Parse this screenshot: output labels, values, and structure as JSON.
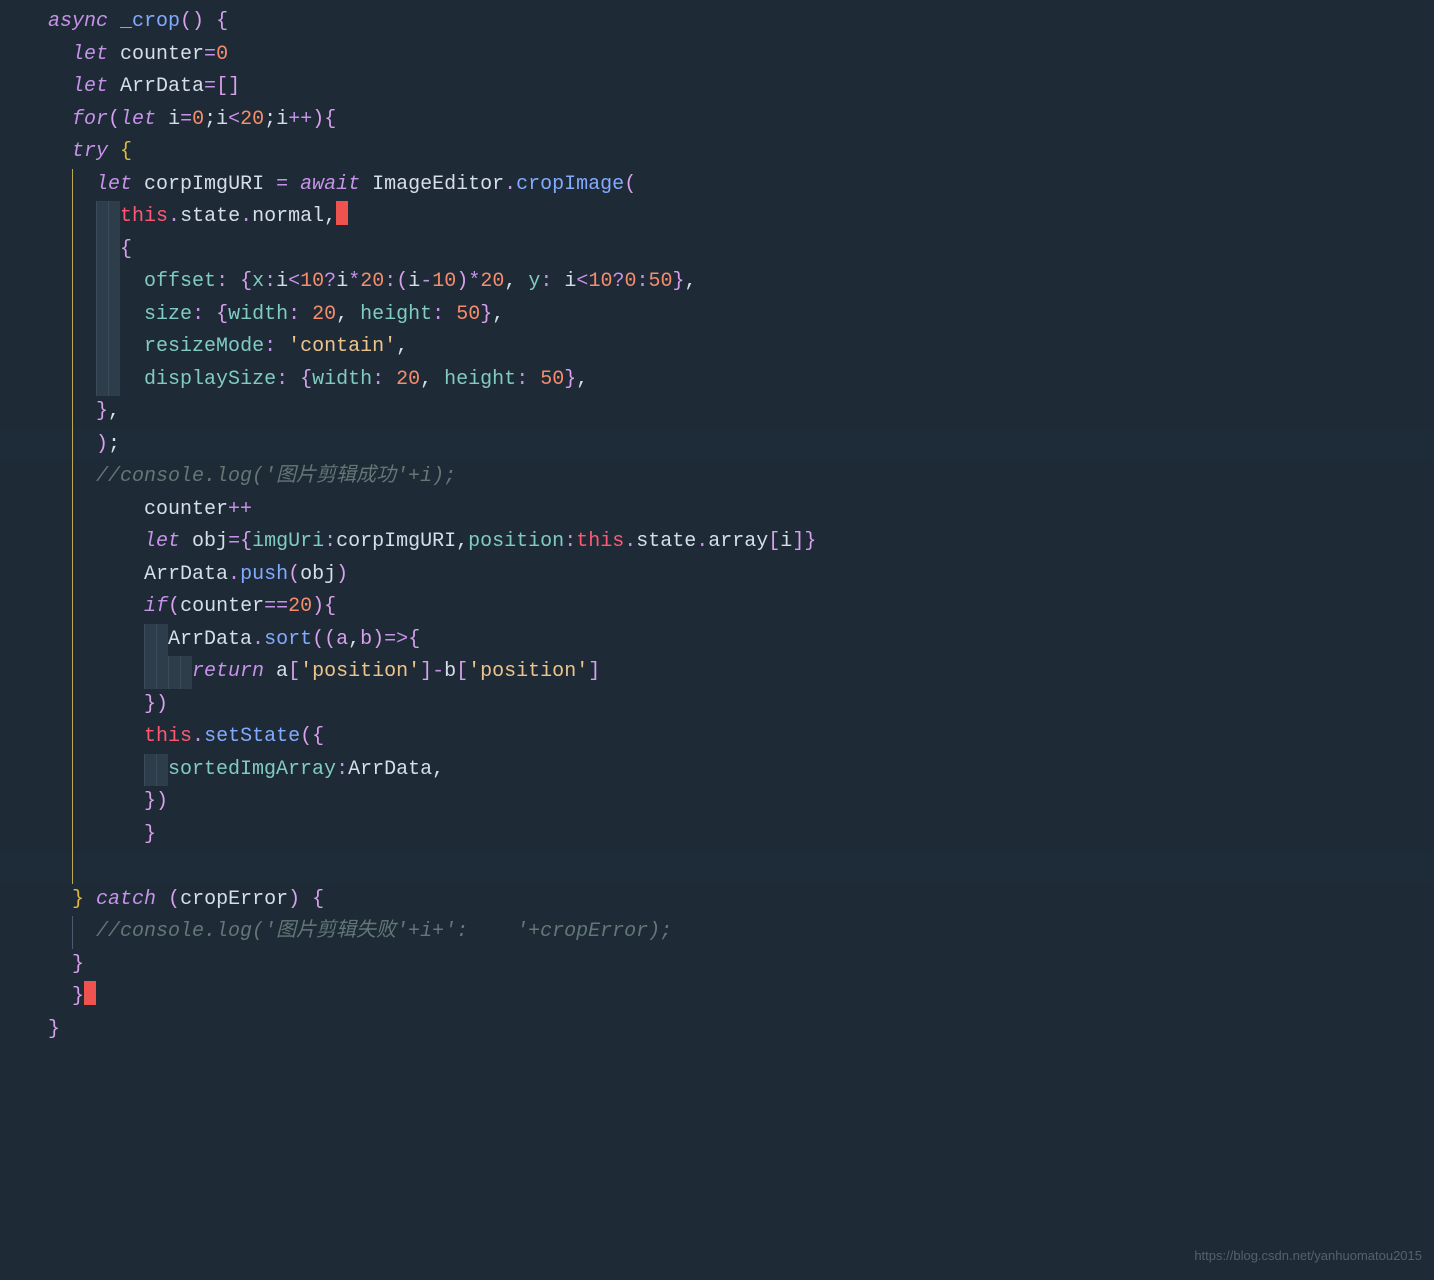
{
  "code": {
    "l1_async": "async",
    "l1_fn": "_crop",
    "l1_paren": "()",
    "l1_brace": " {",
    "l2_let": "let",
    "l2_var": " counter",
    "l2_eq": "=",
    "l2_val": "0",
    "l3_let": "let",
    "l3_var": " ArrData",
    "l3_eq": "=",
    "l3_val": "[]",
    "l4_for": "for",
    "l4_open": "(",
    "l4_let": "let",
    "l4_body": " i",
    "l4_eq1": "=",
    "l4_n0": "0",
    "l4_semi1": ";",
    "l4_i2": "i",
    "l4_lt": "<",
    "l4_n20": "20",
    "l4_semi2": ";",
    "l4_i3": "i",
    "l4_inc": "++",
    "l4_close": ")",
    "l4_brace": "{",
    "l5_try": "try",
    "l5_brace": " {",
    "l6_let": "let",
    "l6_var": " corpImgURI ",
    "l6_eq": "=",
    "l6_await": " await ",
    "l6_class": "ImageEditor",
    "l6_dot": ".",
    "l6_method": "cropImage",
    "l6_paren": "(",
    "l7_this": "this",
    "l7_dot1": ".",
    "l7_state": "state",
    "l7_dot2": ".",
    "l7_normal": "normal",
    "l7_comma": ",",
    "l8_brace": "{",
    "l9_offset": "offset",
    "l9_colon": ": ",
    "l9_brace": "{",
    "l9_x": "x",
    "l9_xc": ":",
    "l9_i": "i",
    "l9_lt": "<",
    "l9_10": "10",
    "l9_q": "?",
    "l9_i2": "i",
    "l9_mul": "*",
    "l9_20": "20",
    "l9_c2": ":",
    "l9_p1": "(",
    "l9_i3": "i",
    "l9_min": "-",
    "l9_10b": "10",
    "l9_p2": ")",
    "l9_mul2": "*",
    "l9_20b": "20",
    "l9_cm": ",",
    "l9_y": " y",
    "l9_yc": ": ",
    "l9_i4": "i",
    "l9_lt2": "<",
    "l9_10c": "10",
    "l9_q2": "?",
    "l9_0": "0",
    "l9_c3": ":",
    "l9_50": "50",
    "l9_cb": "}",
    "l9_cm2": ",",
    "l10_size": "size",
    "l10_c": ": ",
    "l10_ob": "{",
    "l10_width": "width",
    "l10_wc": ": ",
    "l10_20": "20",
    "l10_cm": ",",
    "l10_height": " height",
    "l10_hc": ": ",
    "l10_50": "50",
    "l10_cb": "}",
    "l10_cm2": ",",
    "l11_rm": "resizeMode",
    "l11_c": ": ",
    "l11_str": "'contain'",
    "l11_cm": ",",
    "l12_ds": "displaySize",
    "l12_c": ": ",
    "l12_ob": "{",
    "l12_width": "width",
    "l12_wc": ": ",
    "l12_20": "20",
    "l12_cm": ",",
    "l12_height": " height",
    "l12_hc": ": ",
    "l12_50": "50",
    "l12_cb": "}",
    "l12_cm2": ",",
    "l13_cb": "}",
    "l13_cm": ",",
    "l14_cp": ")",
    "l14_semi": ";",
    "l15_comment": "//console.log('图片剪辑成功'+i);",
    "l16_var": "counter",
    "l16_inc": "++",
    "l17_let": "let",
    "l17_var": " obj",
    "l17_eq": "=",
    "l17_ob": "{",
    "l17_imgUri": "imgUri",
    "l17_c1": ":",
    "l17_corp": "corpImgURI",
    "l17_cm": ",",
    "l17_pos": "position",
    "l17_c2": ":",
    "l17_this": "this",
    "l17_d1": ".",
    "l17_state": "state",
    "l17_d2": ".",
    "l17_array": "array",
    "l17_ob2": "[",
    "l17_i": "i",
    "l17_cb2": "]",
    "l17_cb": "}",
    "l18_var": "ArrData",
    "l18_d": ".",
    "l18_push": "push",
    "l18_op": "(",
    "l18_obj": "obj",
    "l18_cp": ")",
    "l19_if": "if",
    "l19_op": "(",
    "l19_var": "counter",
    "l19_eq": "==",
    "l19_20": "20",
    "l19_cp": ")",
    "l19_ob": "{",
    "l20_var": "ArrData",
    "l20_d": ".",
    "l20_sort": "sort",
    "l20_op": "(",
    "l20_op2": "(",
    "l20_a": "a",
    "l20_cm": ",",
    "l20_b": "b",
    "l20_cp2": ")",
    "l20_arrow": "=>",
    "l20_ob": "{",
    "l21_ret": "return",
    "l21_a": " a",
    "l21_ob": "[",
    "l21_str1": "'position'",
    "l21_cb": "]",
    "l21_min": "-",
    "l21_b": "b",
    "l21_ob2": "[",
    "l21_str2": "'position'",
    "l21_cb2": "]",
    "l22_cb": "}",
    "l22_cp": ")",
    "l23_this": "this",
    "l23_d": ".",
    "l23_ss": "setState",
    "l23_op": "(",
    "l23_ob": "{",
    "l24_sia": "sortedImgArray",
    "l24_c": ":",
    "l24_var": "ArrData",
    "l24_cm": ",",
    "l25_cb": "}",
    "l25_cp": ")",
    "l26_cb": "}",
    "l28_cb": "}",
    "l28_catch": " catch ",
    "l28_op": "(",
    "l28_err": "cropError",
    "l28_cp": ")",
    "l28_ob": " {",
    "l29_comment": "//console.log('图片剪辑失败'+i+':    '+cropError);",
    "l30_cb": "}",
    "l31_cb": "}",
    "l32_cb": "}"
  },
  "watermark": "https://blog.csdn.net/yanhuomatou2015"
}
